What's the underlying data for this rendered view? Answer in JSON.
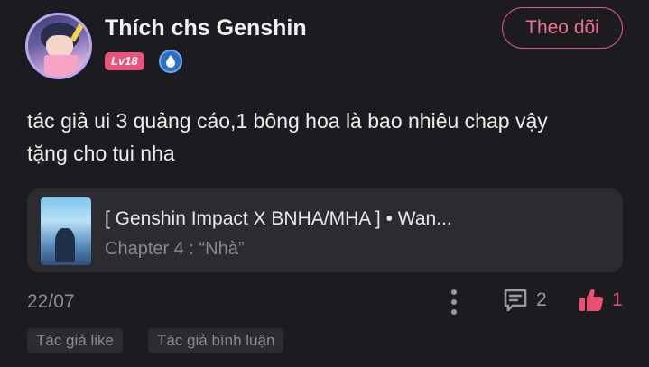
{
  "user": {
    "name": "Thích chs Genshin",
    "level": "Lv18",
    "avatar_icon": "user-avatar",
    "verify_icon": "water-drop-badge-icon"
  },
  "follow_button": {
    "label": "Theo dõi"
  },
  "comment": {
    "text_line1": "tác giả ui 3 quảng cáo,1 bông hoa là bao nhiêu chap vậy",
    "text_line2": "tặng cho tui nha"
  },
  "story": {
    "title": "[ Genshin Impact X BNHA/MHA ] • Wan...",
    "chapter": "Chapter 4 : “Nhà”"
  },
  "footer": {
    "date": "22/07",
    "comment_count": "2",
    "like_count": "1"
  },
  "tags": [
    "Tác giả like",
    "Tác giả bình luận"
  ],
  "colors": {
    "accent": "#ec4f74",
    "background": "#1c1b1f",
    "card": "#2c2b30"
  }
}
